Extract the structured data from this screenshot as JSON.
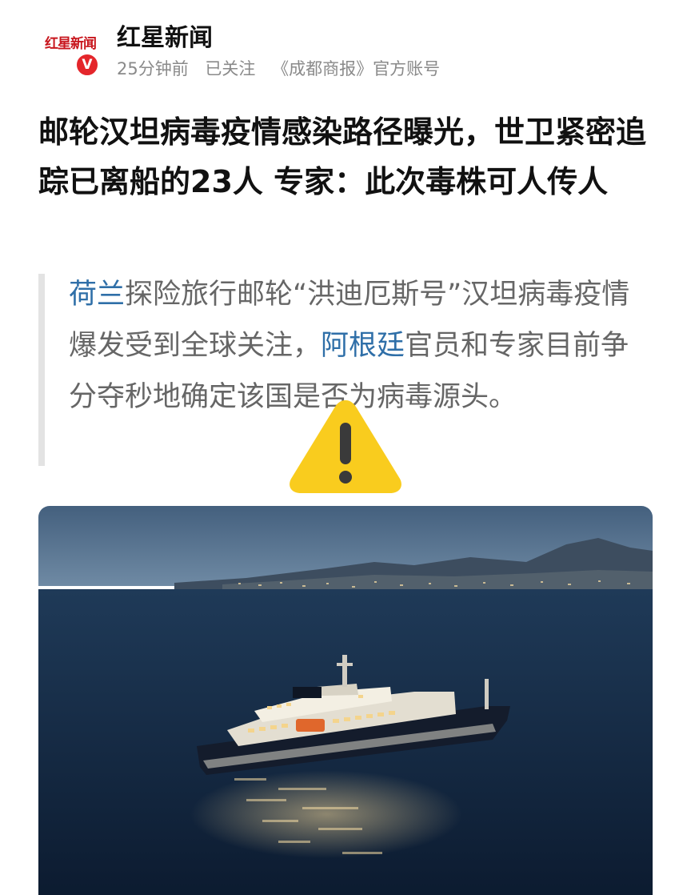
{
  "header": {
    "logo_text": "红星新闻",
    "badge": "V",
    "source_name": "红星新闻",
    "time": "25分钟前",
    "follow_status": "已关注",
    "account_desc": "《成都商报》官方账号"
  },
  "article": {
    "headline": "邮轮汉坦病毒疫情感染路径曝光，世卫紧密追踪已离船的23人 专家：此次毒株可人传人",
    "quote": {
      "link1": "荷兰",
      "text1": "探险旅行邮轮“洪迪厄斯号”汉坦病毒疫情爆发受到全球关注，",
      "link2": "阿根廷",
      "text2": "官员和专家目前争分夺秒地确定该国是否为病毒源头。"
    }
  },
  "icons": {
    "avatar": "red-star-news-logo",
    "verified": "verified-v-badge",
    "warning": "warning-triangle-icon"
  },
  "colors": {
    "brand_red": "#c8161d",
    "link_blue": "#2f6fa8",
    "warning_yellow": "#f9cc1e"
  }
}
